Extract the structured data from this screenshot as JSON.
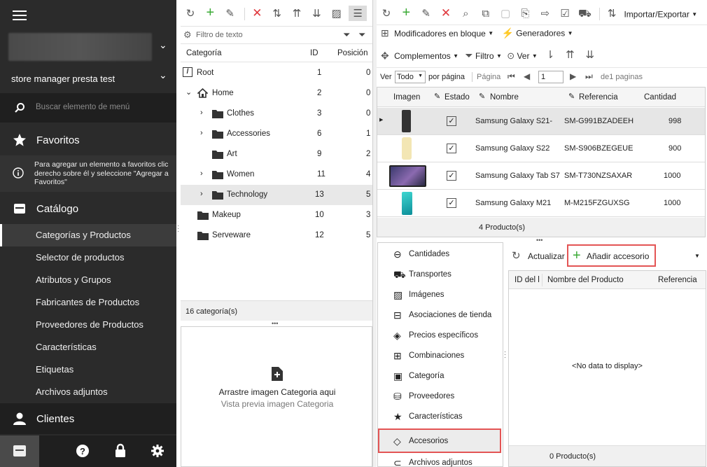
{
  "sidebar": {
    "store_label": "store manager presta test",
    "search_placeholder": "Buscar elemento de menú",
    "favorites": {
      "title": "Favoritos",
      "hint": "Para agregar un elemento a favoritos clic derecho sobre él y seleccione \"Agregar a Favoritos\""
    },
    "catalog": {
      "title": "Catálogo",
      "items": [
        {
          "label": "Categorías y Productos"
        },
        {
          "label": "Selector de productos"
        },
        {
          "label": "Atributos y Grupos"
        },
        {
          "label": "Fabricantes de Productos"
        },
        {
          "label": "Proveedores de Productos"
        },
        {
          "label": "Características"
        },
        {
          "label": "Etiquetas"
        },
        {
          "label": "Archivos adjuntos"
        }
      ]
    },
    "clients": {
      "title": "Clientes"
    }
  },
  "categories": {
    "filter_placeholder": "Filtro de texto",
    "columns": {
      "category": "Categoría",
      "id": "ID",
      "position": "Posición"
    },
    "rows": [
      {
        "name": "Root",
        "id": "1",
        "pos": "0"
      },
      {
        "name": "Home",
        "id": "2",
        "pos": "0"
      },
      {
        "name": "Clothes",
        "id": "3",
        "pos": "0"
      },
      {
        "name": "Accessories",
        "id": "6",
        "pos": "1"
      },
      {
        "name": "Art",
        "id": "9",
        "pos": "2"
      },
      {
        "name": "Women",
        "id": "11",
        "pos": "4"
      },
      {
        "name": "Technology",
        "id": "13",
        "pos": "5"
      },
      {
        "name": "Makeup",
        "id": "10",
        "pos": "3"
      },
      {
        "name": "Serveware",
        "id": "12",
        "pos": "5"
      }
    ],
    "footer": "16 categoría(s)",
    "drop_title": "Arrastre imagen Categoria aqui",
    "drop_sub": "Vista previa imagen Categoria"
  },
  "products": {
    "toolbar": {
      "import_export": "Importar/Exportar",
      "bulk": "Modificadores en bloque",
      "generators": "Generadores",
      "addons": "Complementos",
      "filter": "Filtro",
      "view": "Ver"
    },
    "paging": {
      "ver": "Ver",
      "todo": "Todo",
      "per_page": "por página",
      "page_label": "Página",
      "page_value": "1",
      "of_pages": "de1 paginas"
    },
    "columns": {
      "image": "Imagen",
      "status": "Estado",
      "name": "Nombre",
      "ref": "Referencia",
      "qty": "Cantidad"
    },
    "rows": [
      {
        "name": "Samsung Galaxy S21-",
        "ref": "SM-G991BZADEEH",
        "qty": "998",
        "checked": "✓"
      },
      {
        "name": "Samsung Galaxy S22",
        "ref": "SM-S906BZEGEUE",
        "qty": "900",
        "checked": "✓"
      },
      {
        "name": "Samsung Galaxy Tab S7",
        "ref": "SM-T730NZSAXAR",
        "qty": "1000",
        "checked": "✓"
      },
      {
        "name": "Samsung Galaxy M21",
        "ref": "M-M215FZGUXSG",
        "qty": "1000",
        "checked": "✓"
      }
    ],
    "footer": "4 Producto(s)"
  },
  "details": {
    "items": [
      {
        "label": "Cantidades"
      },
      {
        "label": "Transportes"
      },
      {
        "label": "Imágenes"
      },
      {
        "label": "Asociaciones de tienda"
      },
      {
        "label": "Precios específicos"
      },
      {
        "label": "Combinaciones"
      },
      {
        "label": "Categoría"
      },
      {
        "label": "Proveedores"
      },
      {
        "label": "Características"
      },
      {
        "label": "Accesorios"
      },
      {
        "label": "Archivos adjuntos"
      }
    ]
  },
  "accessories": {
    "refresh": "Actualizar",
    "add": "Añadir accesorio",
    "columns": {
      "id": "ID del l",
      "name": "Nombre del Producto",
      "ref": "Referencia"
    },
    "empty": "<No data to display>",
    "footer": "0 Producto(s)"
  },
  "colors": {
    "sidebar": "#2b2b2b",
    "sidebar_dark": "#1f1f1f",
    "accent_red": "#e0393e",
    "accent_green": "#3aaa35",
    "highlight": "#e35454"
  }
}
